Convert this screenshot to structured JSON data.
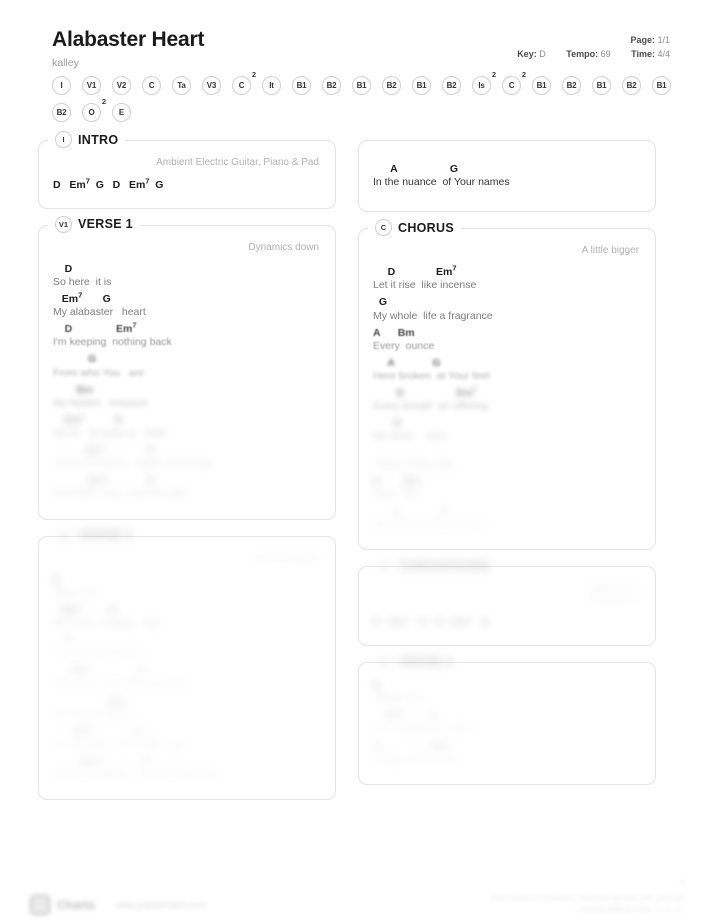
{
  "header": {
    "title": "Alabaster Heart",
    "artist": "kalley",
    "page_label": "Page:",
    "page_value": "1/1",
    "key_label": "Key:",
    "key_value": "D",
    "tempo_label": "Tempo:",
    "tempo_value": "69",
    "time_label": "Time:",
    "time_value": "4/4"
  },
  "arrangement": [
    {
      "code": "I",
      "sup": ""
    },
    {
      "code": "V1",
      "sup": ""
    },
    {
      "code": "V2",
      "sup": ""
    },
    {
      "code": "C",
      "sup": ""
    },
    {
      "code": "Ta",
      "sup": ""
    },
    {
      "code": "V3",
      "sup": ""
    },
    {
      "code": "C",
      "sup": "2"
    },
    {
      "code": "It",
      "sup": ""
    },
    {
      "code": "B1",
      "sup": ""
    },
    {
      "code": "B2",
      "sup": ""
    },
    {
      "code": "B1",
      "sup": ""
    },
    {
      "code": "B2",
      "sup": ""
    },
    {
      "code": "B1",
      "sup": ""
    },
    {
      "code": "B2",
      "sup": ""
    },
    {
      "code": "Is",
      "sup": "2"
    },
    {
      "code": "C",
      "sup": "2"
    },
    {
      "code": "B1",
      "sup": ""
    },
    {
      "code": "B2",
      "sup": ""
    },
    {
      "code": "B1",
      "sup": ""
    },
    {
      "code": "B2",
      "sup": ""
    },
    {
      "code": "B1",
      "sup": ""
    },
    {
      "code": "B2",
      "sup": ""
    },
    {
      "code": "O",
      "sup": "2"
    },
    {
      "code": "E",
      "sup": ""
    }
  ],
  "sections": {
    "intro": {
      "badge": "I",
      "title": "INTRO",
      "note": "Ambient Electric Guitar, Piano & Pad",
      "chords": "D   Em7  G   D   Em7  G"
    },
    "intro_lyric": {
      "chords": "      A                  G",
      "lyrics": "In the nuance  of Your names"
    },
    "verse1": {
      "badge": "V1",
      "title": "VERSE 1",
      "note": "Dynamics down",
      "lines": [
        {
          "chords": "    D",
          "lyrics": "So here  it is",
          "blur": 0
        },
        {
          "chords": "   Em7       G",
          "lyrics": "My alabaster   heart",
          "blur": 0
        },
        {
          "chords": "    D               Em7",
          "lyrics": "I'm keeping  nothing back",
          "blur": 1
        },
        {
          "chords": "            G",
          "lyrics": "From who You   are",
          "blur": 2
        },
        {
          "chords": "        Bm",
          "lyrics": "No hidden   treasure",
          "blur": 3
        },
        {
          "chords": "    Em7          G",
          "lyrics": "Never   to keep or   hold",
          "blur": 4
        },
        {
          "chords": "           Em7              G",
          "lyrics": "You're a lifetime   worth of worship",
          "blur": 5
        },
        {
          "chords": "            Em7             G",
          "lyrics": "And that's only   just the start",
          "blur": 5
        }
      ]
    },
    "chorus": {
      "badge": "C",
      "title": "CHORUS",
      "note": "A little bigger",
      "lines": [
        {
          "chords": "     D              Em7",
          "lyrics": "Let it rise  like incense",
          "blur": 0
        },
        {
          "chords": "  G",
          "lyrics": "My whole  life a fragrance",
          "blur": 0
        },
        {
          "chords": "A      Bm",
          "lyrics": "Every  ounce",
          "blur": 1
        },
        {
          "chords": "     A             G",
          "lyrics": "Here broken  at Your feet",
          "blur": 2
        },
        {
          "chords": "        D                  Em7",
          "lyrics": "Every breath  an offering",
          "blur": 3
        },
        {
          "chords": "       G",
          "lyrics": "My heart    cries",
          "blur": 4
        },
        {
          "chords": "",
          "lyrics": "These longs sing",
          "blur": 5
        },
        {
          "chords": "D        Bm",
          "lyrics": "Hear  You",
          "blur": 5
        },
        {
          "chords": "       A              G",
          "lyrics": "My worthy  King of kings",
          "blur": 6
        }
      ]
    },
    "verse2": {
      "badge": "V2",
      "title": "VERSE 2",
      "note": "Worship again",
      "lines": [
        {
          "chords": "D",
          "lyrics": "Here  it is",
          "blur": 5
        },
        {
          "chords": "   Em7         G",
          "lyrics": "My every  waiting   day",
          "blur": 5
        },
        {
          "chords": "    D",
          "lyrics": "The minutes  hours",
          "blur": 6
        },
        {
          "chords": "      Em7                G",
          "lyrics": "The years  of endless  praise",
          "blur": 6
        },
        {
          "chords": "                   Bm",
          "lyrics": "For You're worthy",
          "blur": 6
        },
        {
          "chords": "       Em7              G",
          "lyrics": "For beyond   all I could   say",
          "blur": 6
        },
        {
          "chords": "          Em7              G",
          "lyrics": "There's a lifetime   worth of worship",
          "blur": 6
        }
      ]
    },
    "turnaround": {
      "badge": "Ta",
      "title": "TURNAROUND",
      "note": "Half beat to\nSoft groove",
      "chords": "D   Em7   G   D   Em7   G"
    },
    "verse3": {
      "badge": "V3",
      "title": "VERSE 3",
      "lines": [
        {
          "chords": "D",
          "lyrics": "There  it is",
          "blur": 5
        },
        {
          "chords": "    Em7        G",
          "lyrics": "Your alabaster  cross",
          "blur": 6
        },
        {
          "chords": "D                 Em7",
          "lyrics": "Giving  all You are",
          "blur": 6
        }
      ]
    }
  },
  "footer": {
    "brand": "Charts",
    "url": "www.praisecharts.com",
    "line1": "Music Resource Collection | Song Arrangement: Ref | Worship",
    "line2": "Licensed Material Copy — Lic. 1/1",
    "pageno": "1"
  }
}
